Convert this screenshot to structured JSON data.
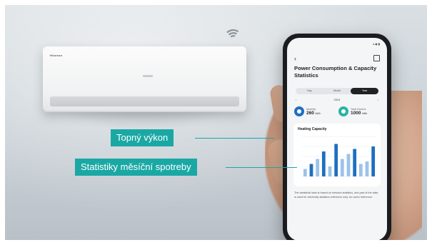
{
  "scene": {
    "ac_unit": {
      "brand": "Hisense"
    },
    "colors": {
      "accent": "#1aa8a4",
      "bar_blue": "#1f6fc0",
      "bar_light": "#9cc3ea",
      "metric_teal": "#2ab3a8",
      "metric_blue": "#1f6fc0"
    }
  },
  "phone": {
    "status": "◂ ◉ ▮",
    "back_icon": "chevron-left-icon",
    "title": "Power Consumption & Capacity Statistics",
    "segments": [
      {
        "label": "Day",
        "active": false
      },
      {
        "label": "Month",
        "active": false
      },
      {
        "label": "Year",
        "active": true
      }
    ],
    "date_nav": {
      "prev": "‹",
      "current": "2024",
      "next": "›"
    },
    "metrics": [
      {
        "label": "Monthly",
        "value": "260",
        "unit": "kWh"
      },
      {
        "label": "Total Electric",
        "value": "1000",
        "unit": "kWh"
      }
    ],
    "card_title": "Heating Capacity",
    "paragraph": "The statistical data is based on network statistics, and part of the data is used for electricity statistics reference only, for users reference."
  },
  "chart_data": {
    "type": "bar",
    "title": "Heating Capacity",
    "categories": [
      "1",
      "2",
      "3",
      "4",
      "5",
      "6",
      "7",
      "8",
      "9",
      "10",
      "11",
      "12"
    ],
    "series": [
      {
        "values": [
          3,
          5,
          7,
          10,
          4,
          13,
          7,
          9,
          11,
          5,
          6,
          12
        ]
      }
    ],
    "highlighted": [
      false,
      true,
      false,
      true,
      false,
      true,
      false,
      false,
      true,
      false,
      false,
      true
    ],
    "ylim": [
      0,
      16
    ],
    "grid": true
  },
  "callouts": [
    {
      "label": "Topný výkon"
    },
    {
      "label": "Statistiky měsíční spotreby"
    }
  ]
}
